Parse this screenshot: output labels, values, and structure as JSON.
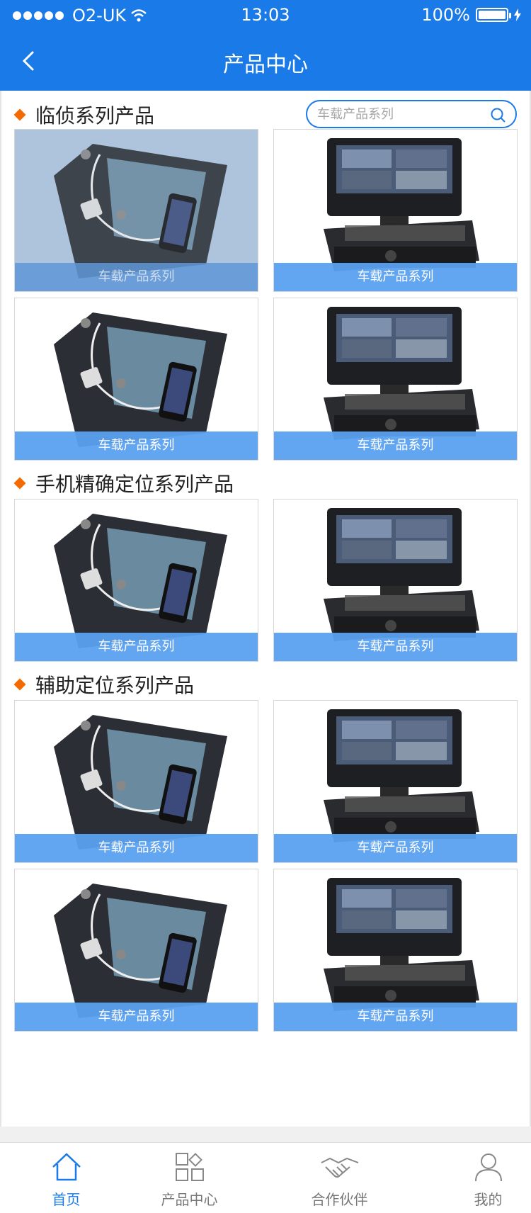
{
  "status_bar": {
    "carrier": "O2-UK",
    "time": "13:03",
    "battery": "100%"
  },
  "header": {
    "title": "产品中心"
  },
  "search": {
    "placeholder": "车载产品系列"
  },
  "sections": [
    {
      "title": "临侦系列产品"
    },
    {
      "title": "手机精确定位系列产品"
    },
    {
      "title": "辅助定位系列产品"
    }
  ],
  "card_label": "车载产品系列",
  "products": [
    {
      "label": "车载产品系列",
      "image": "solar-charger-phone"
    },
    {
      "label": "车载产品系列",
      "image": "vehicle-dvr-monitor"
    },
    {
      "label": "车载产品系列",
      "image": "solar-charger-phone"
    },
    {
      "label": "车载产品系列",
      "image": "vehicle-dvr-monitor"
    },
    {
      "label": "车载产品系列",
      "image": "solar-charger-phone"
    },
    {
      "label": "车载产品系列",
      "image": "vehicle-dvr-monitor"
    },
    {
      "label": "车载产品系列",
      "image": "solar-charger-phone"
    },
    {
      "label": "车载产品系列",
      "image": "vehicle-dvr-monitor"
    },
    {
      "label": "车载产品系列",
      "image": "solar-charger-phone"
    },
    {
      "label": "车载产品系列",
      "image": "vehicle-dvr-monitor"
    }
  ],
  "tabbar": {
    "items": [
      {
        "label": "首页",
        "icon": "home-icon",
        "active": true
      },
      {
        "label": "产品中心",
        "icon": "grid-icon",
        "active": false
      },
      {
        "label": "合作伙伴",
        "icon": "handshake-icon",
        "active": false
      },
      {
        "label": "我的",
        "icon": "user-icon",
        "active": false
      }
    ]
  },
  "colors": {
    "brand": "#1a7ae8",
    "accent": "#f56a00",
    "label_bg": "#5aa0f0"
  }
}
